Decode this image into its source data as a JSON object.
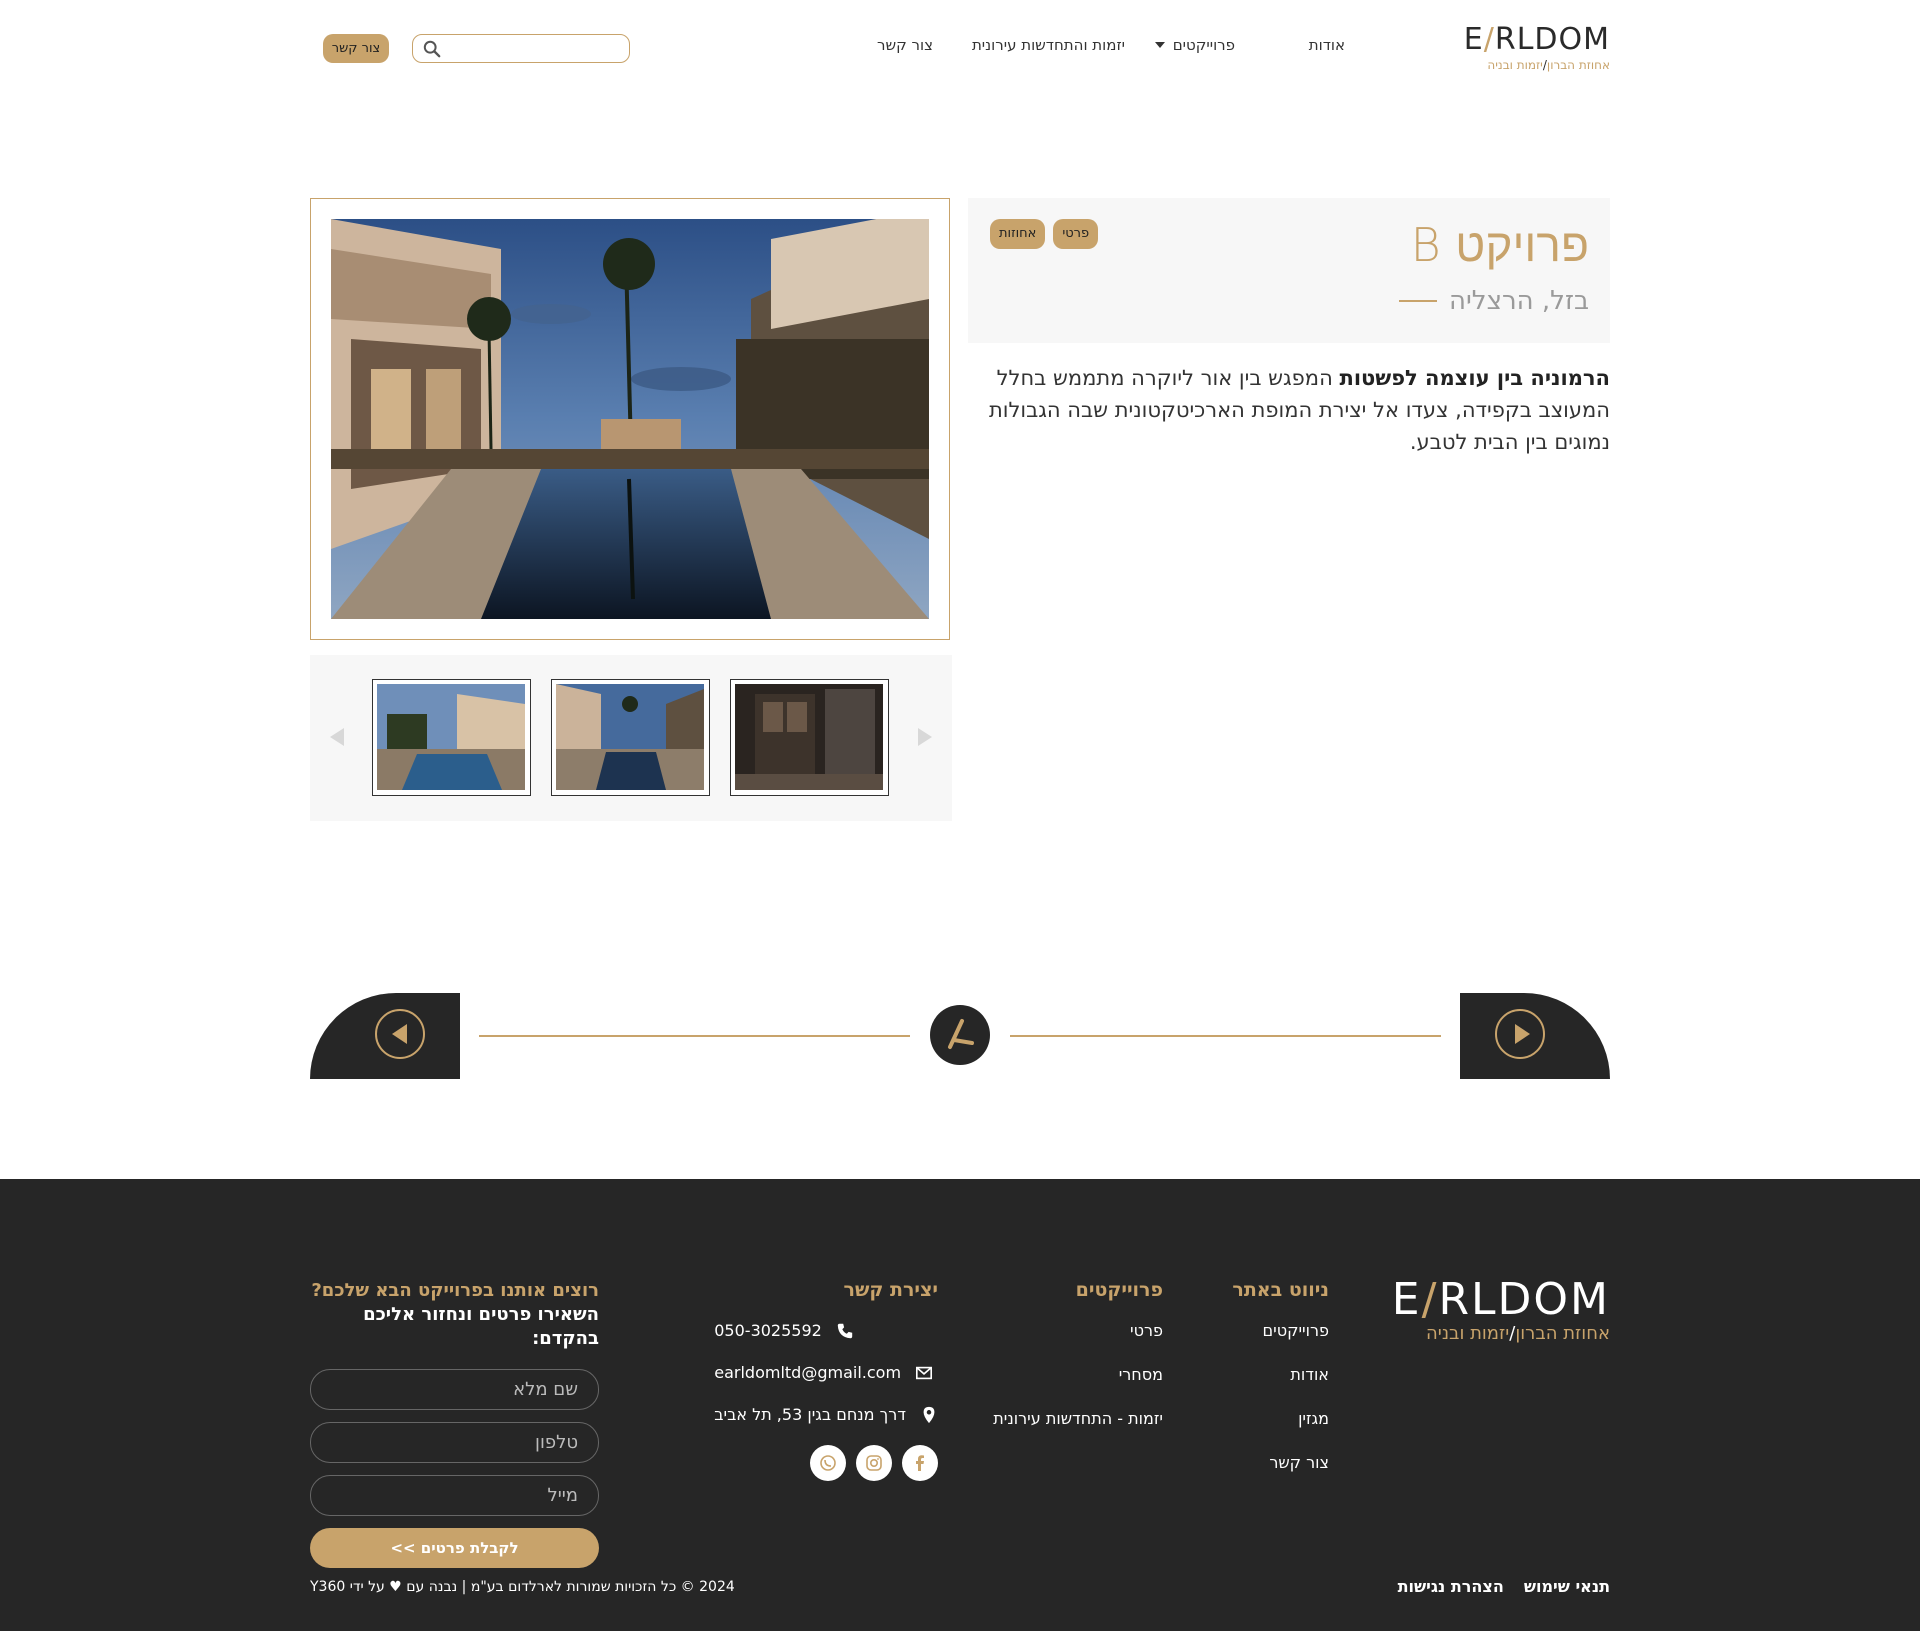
{
  "header": {
    "logo_text": "EARLDOM",
    "logo_tag_left": "אחוזת הברון",
    "logo_tag_right": "יזמות ובניה",
    "nav": {
      "about": "אודות",
      "projects": "פרוייקטים",
      "initiative": "יזמות והתחדשות עירונית",
      "contact": "צור קשר"
    },
    "search_placeholder": "",
    "cta": "צור קשר"
  },
  "project": {
    "title": "פרויקט B",
    "location": "בזל, הרצליה",
    "tags": [
      "אחוזות",
      "פרטי"
    ],
    "description_bold": "הרמוניה בין עוצמה לפשטות",
    "description_rest": " המפגש בין אור ליוקרה מתממש בחלל המעוצב בקפידה, צעדו אל יצירת המופת הארכיטקטונית שבה הגבולות נמוגים בין הבית לטבע."
  },
  "gallery": {
    "thumbnails": [
      "pool-house-day",
      "pool-house-dusk",
      "closet-interior"
    ]
  },
  "footer": {
    "logo_text": "EARLDOM",
    "logo_tag_left": "אחוזת הברון",
    "logo_tag_right": "יזמות ובניה",
    "nav_heading": "ניווט באתר",
    "nav_links": [
      "פרוייקטים",
      "אודות",
      "מגזין",
      "צור קשר"
    ],
    "projects_heading": "פרוייקטים",
    "projects_links": [
      "פרטי",
      "מסחרי",
      "יזמות - התחדשות עירונית"
    ],
    "contact_heading": "יצירת קשר",
    "phone": "050-3025592",
    "email": "earldomltd@gmail.com",
    "address": "דרך מנחם בגין 53, תל אביב",
    "social_icons": [
      "facebook-icon",
      "instagram-icon",
      "whatsapp-icon"
    ],
    "form_heading": "רוצים אותנו בפרוייקט הבא שלכם?",
    "form_sub": "השאירו פרטים ונחזור אליכם בהקדם:",
    "form_name_placeholder": "שם מלא",
    "form_phone_placeholder": "טלפון",
    "form_email_placeholder": "מייל",
    "form_submit": "לקבלת פרטים >>",
    "terms": "תנאי שימוש",
    "accessibility": "הצהרת נגישות",
    "copyright": "2024 © כל הזכויות שמורות לארלדום בע\"מ | נבנה עם ♥ על ידי Y360"
  },
  "colors": {
    "accent": "#c8a36b",
    "dark": "#262626",
    "panel": "#f7f7f7"
  }
}
